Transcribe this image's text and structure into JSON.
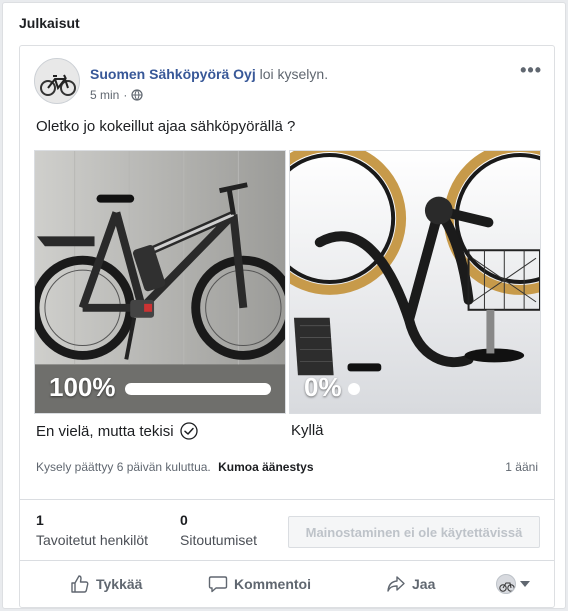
{
  "section": {
    "title": "Julkaisut"
  },
  "post": {
    "author": "Suomen Sähköpyörä Oyj",
    "action": "loi kyselyn.",
    "time": "5 min",
    "dot": "·",
    "privacy_icon": "globe-icon",
    "more_icon": "more-dots-icon",
    "more_text": "•••",
    "question": "Oletko jo kokeillut ajaa sähköpyörällä ?"
  },
  "poll": {
    "options": [
      {
        "label": "En vielä, mutta tekisi",
        "percent_text": "100%",
        "percent": 100,
        "selected": true
      },
      {
        "label": "Kyllä",
        "percent_text": "0%",
        "percent": 0,
        "selected": false
      }
    ],
    "footer_text": "Kysely päättyy 6 päivän kuluttua.",
    "undo_label": "Kumoa äänestys",
    "vote_count": "1 ääni"
  },
  "stats": {
    "reach_value": "1",
    "reach_label": "Tavoitetut henkilöt",
    "engagement_value": "0",
    "engagement_label": "Sitoutumiset",
    "promote_label": "Mainostaminen ei ole käytettävissä"
  },
  "actions": {
    "like": "Tykkää",
    "comment": "Kommentoi",
    "share": "Jaa"
  },
  "colors": {
    "author_link": "#385898",
    "text_secondary": "#606770",
    "border": "#dadde1"
  }
}
